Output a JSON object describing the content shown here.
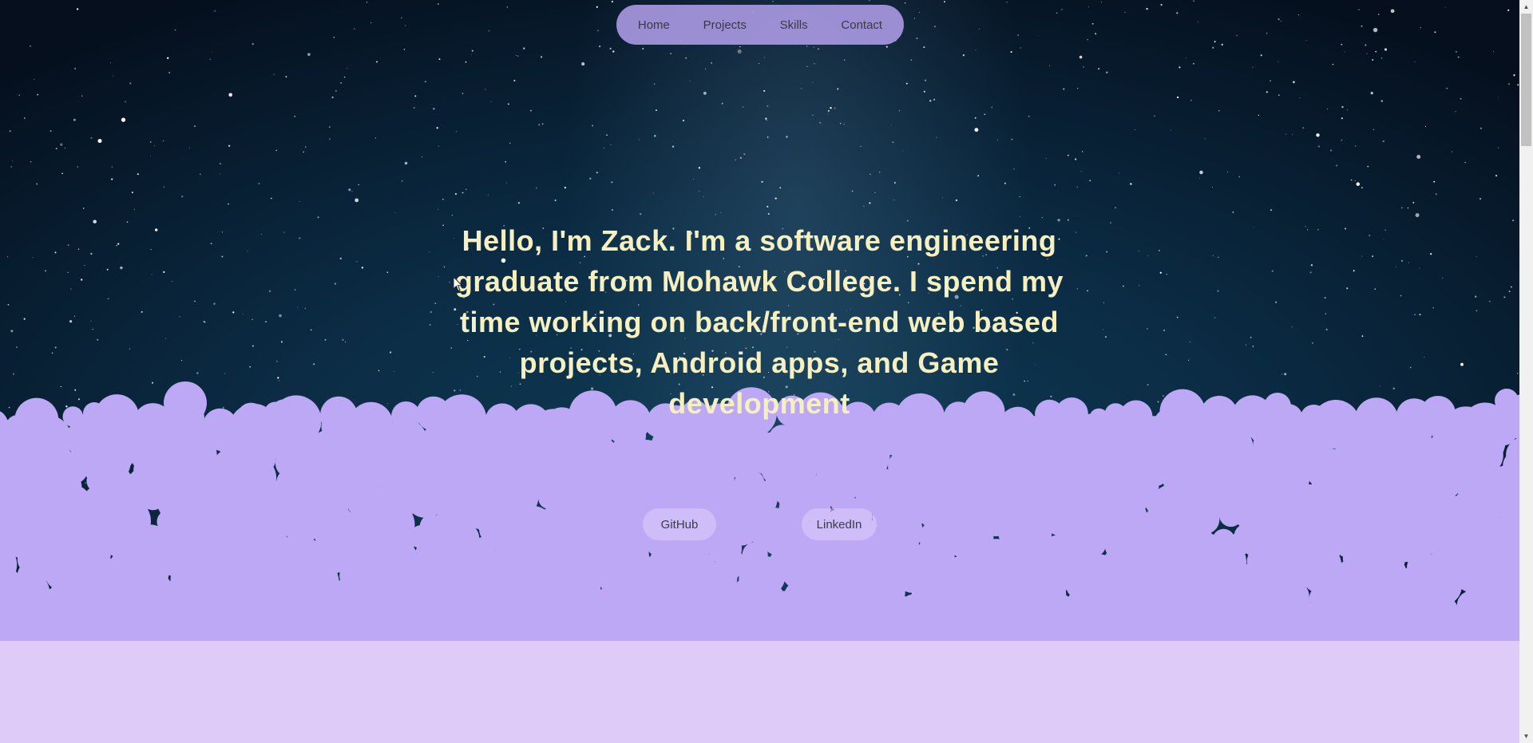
{
  "nav": {
    "items": [
      {
        "label": "Home"
      },
      {
        "label": "Projects"
      },
      {
        "label": "Skills"
      },
      {
        "label": "Contact"
      }
    ]
  },
  "hero": {
    "headline": "Hello, I'm Zack. I'm a software engineering graduate from Mohawk College. I spend my time working on back/front-end web based projects, Android apps, and Game development"
  },
  "social": {
    "github_label": "GitHub",
    "linkedin_label": "LinkedIn"
  },
  "colors": {
    "nav_background": "#b2a0ec",
    "headline_text": "#f6f0c0",
    "bubbles": "#bca8f5",
    "lower_section": "#dfcbf8",
    "sky": "#0b2c44"
  }
}
